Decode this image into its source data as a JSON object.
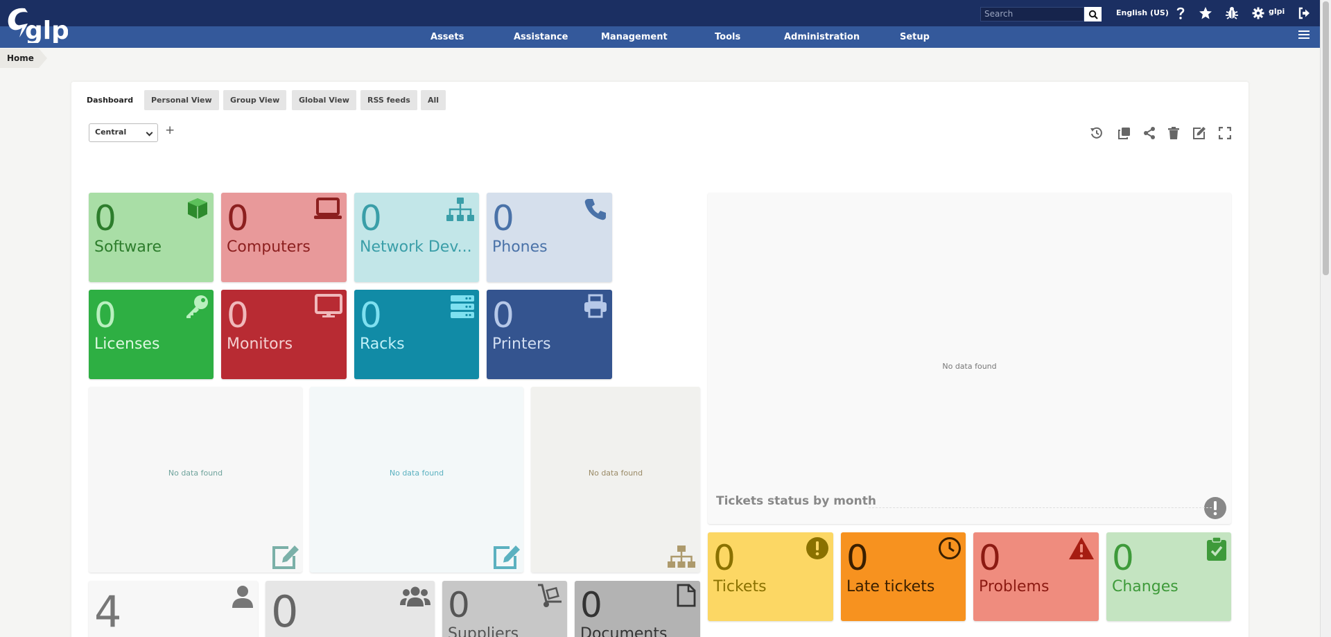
{
  "brand": {
    "logo_text": "glpi"
  },
  "header": {
    "search_placeholder": "Search",
    "language": "English (US)",
    "username": "glpi"
  },
  "menu": [
    "Assets",
    "Assistance",
    "Management",
    "Tools",
    "Administration",
    "Setup"
  ],
  "breadcrumb": {
    "home": "Home"
  },
  "tabs": [
    "Dashboard",
    "Personal View",
    "Group View",
    "Global View",
    "RSS feeds",
    "All"
  ],
  "dashboard": {
    "selected": "Central",
    "add_label": "+"
  },
  "asset_cards": [
    {
      "value": "0",
      "label": "Software",
      "icon": "box-icon"
    },
    {
      "value": "0",
      "label": "Computers",
      "icon": "laptop-icon"
    },
    {
      "value": "0",
      "label": "Network Dev...",
      "icon": "network-icon"
    },
    {
      "value": "0",
      "label": "Phones",
      "icon": "phone-icon"
    },
    {
      "value": "0",
      "label": "Licenses",
      "icon": "key-icon"
    },
    {
      "value": "0",
      "label": "Monitors",
      "icon": "monitor-icon"
    },
    {
      "value": "0",
      "label": "Racks",
      "icon": "server-icon"
    },
    {
      "value": "0",
      "label": "Printers",
      "icon": "printer-icon"
    }
  ],
  "empty_widgets": {
    "no_data": "No data found"
  },
  "tickets_chart": {
    "title": "Tickets status by month",
    "no_data": "No data found"
  },
  "ticket_cards": [
    {
      "value": "0",
      "label": "Tickets",
      "icon": "exclamation-icon"
    },
    {
      "value": "0",
      "label": "Late tickets",
      "icon": "clock-icon"
    },
    {
      "value": "0",
      "label": "Problems",
      "icon": "warning-icon"
    },
    {
      "value": "0",
      "label": "Changes",
      "icon": "clipboard-check-icon"
    }
  ],
  "bottom_cards": [
    {
      "value": "4",
      "label": "",
      "icon": "user-icon"
    },
    {
      "value": "0",
      "label": "",
      "icon": "users-icon"
    },
    {
      "value": "0",
      "label": "Suppliers",
      "icon": "dolly-icon"
    },
    {
      "value": "0",
      "label": "Documents",
      "icon": "file-icon"
    }
  ]
}
